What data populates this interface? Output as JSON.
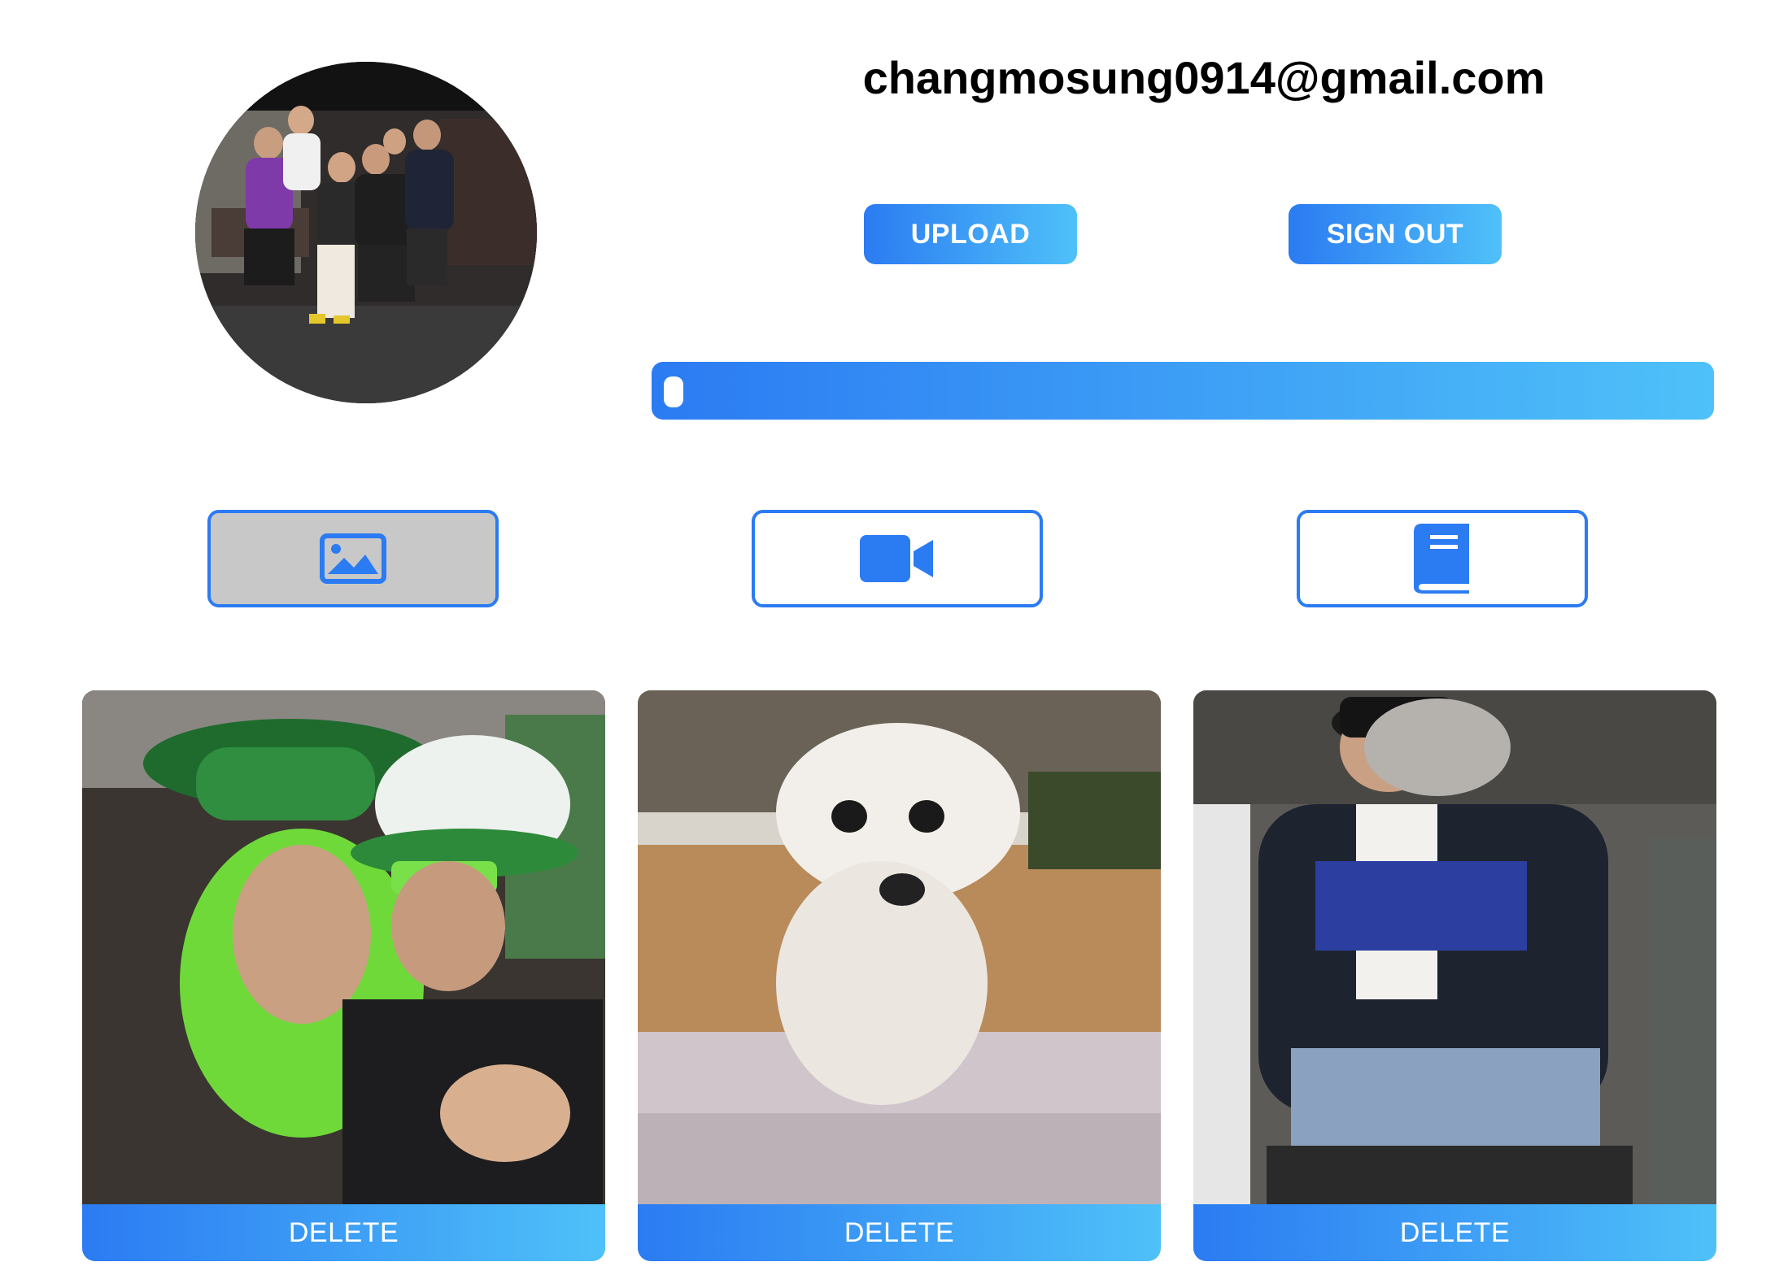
{
  "profile": {
    "email": "changmosung0914@gmail.com",
    "avatar_alt": "profile photo of group of people"
  },
  "actions": {
    "upload_label": "UPLOAD",
    "signout_label": "SIGN OUT"
  },
  "upload_progress": {
    "value_fraction": 0.0
  },
  "media_tabs": [
    {
      "name": "image",
      "icon": "image-icon",
      "active": true
    },
    {
      "name": "video",
      "icon": "video-camera-icon",
      "active": false
    },
    {
      "name": "book",
      "icon": "book-icon",
      "active": false
    }
  ],
  "gallery": {
    "items": [
      {
        "subject": "selfie with green hats and wigs",
        "delete_label": "DELETE"
      },
      {
        "subject": "white fluffy dog",
        "delete_label": "DELETE"
      },
      {
        "subject": "person in VR headset on seat",
        "delete_label": "DELETE"
      }
    ]
  },
  "colors": {
    "accent_start": "#2b7bf2",
    "accent_end": "#4fc1f9",
    "tab_active_bg": "#c8c8c8"
  }
}
